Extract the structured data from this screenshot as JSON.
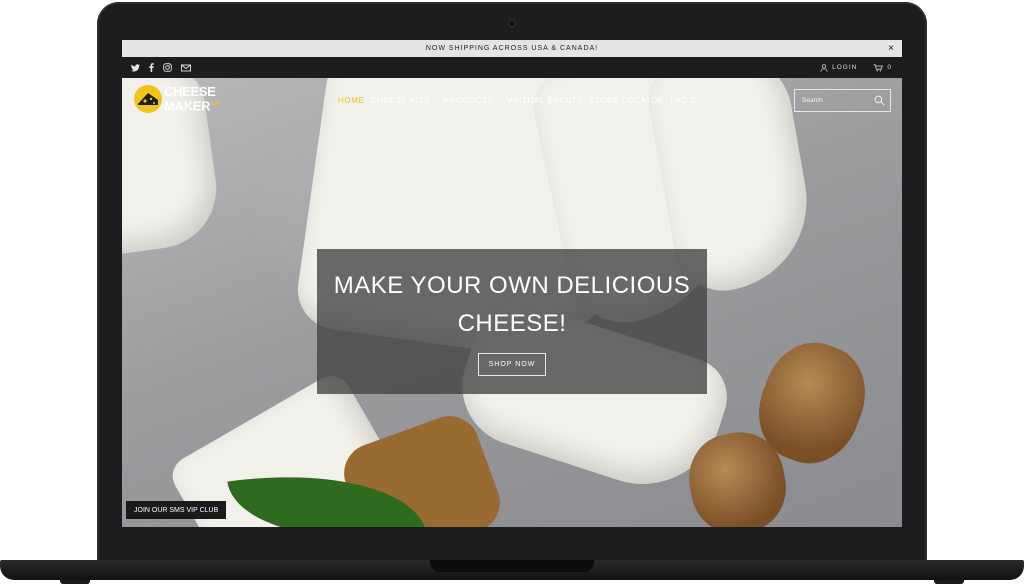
{
  "announcement": {
    "text": "NOW SHIPPING ACROSS USA & CANADA!",
    "close": "×"
  },
  "topbar": {
    "social": [
      "twitter-icon",
      "facebook-icon",
      "instagram-icon",
      "mail-icon"
    ],
    "login": "LOGIN",
    "cart_count": "0"
  },
  "logo": {
    "line1": "CHEESE",
    "line2": "MAKER",
    "suffix": ".CA"
  },
  "nav": {
    "items": [
      {
        "label": "HOME",
        "active": true
      },
      {
        "label": "CHEESE KITS",
        "dropdown": true
      },
      {
        "label": "PRODUCTS",
        "dropdown": true
      },
      {
        "label": "VIRTUAL EVENTS"
      },
      {
        "label": "STORE LOCATOR"
      },
      {
        "label": "FAQ'S"
      }
    ]
  },
  "search": {
    "placeholder": "Search"
  },
  "hero": {
    "headline": "MAKE YOUR OWN DELICIOUS CHEESE!",
    "button": "SHOP NOW"
  },
  "sms": {
    "label": "JOIN OUR SMS VIP CLUB"
  },
  "colors": {
    "accent": "#f3c21b",
    "topbar": "#1b1d1e",
    "announcement_bg": "#e4e4e4"
  }
}
